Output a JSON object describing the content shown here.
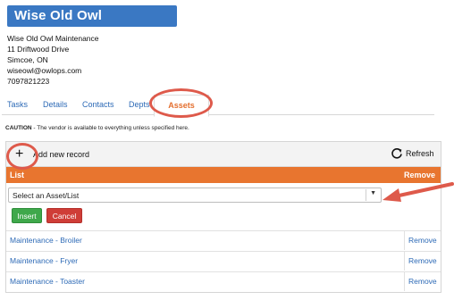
{
  "vendor": {
    "title": "Wise Old Owl Maintenance",
    "address_lines": [
      "Wise Old Owl Maintenance",
      "11 Driftwood Drive",
      "Simcoe, ON",
      "wiseowl@owlops.com",
      "7097821223"
    ]
  },
  "tabs": [
    {
      "label": "Tasks",
      "active": false
    },
    {
      "label": "Details",
      "active": false
    },
    {
      "label": "Contacts",
      "active": false
    },
    {
      "label": "Depts",
      "active": false
    },
    {
      "label": "Assets",
      "active": true
    }
  ],
  "caution": {
    "label": "CAUTION",
    "text": " - The vendor is available to everything unless specified here."
  },
  "toolbar": {
    "add_label": "Add new record",
    "add_icon": "plus-icon",
    "refresh_label": "Refresh",
    "refresh_icon": "refresh-icon"
  },
  "table": {
    "header_list": "List",
    "header_remove": "Remove",
    "select_placeholder": "Select an Asset/List",
    "insert_label": "Insert",
    "cancel_label": "Cancel",
    "rows": [
      {
        "name": "Maintenance - Broiler",
        "action": "Remove"
      },
      {
        "name": "Maintenance - Fryer",
        "action": "Remove"
      },
      {
        "name": "Maintenance - Toaster",
        "action": "Remove"
      }
    ]
  },
  "colors": {
    "brand_blue": "#3a78c3",
    "header_orange": "#e8752f",
    "annotation_red": "#de5a4b",
    "insert_green": "#3fa84b",
    "cancel_red": "#cf3d37"
  }
}
